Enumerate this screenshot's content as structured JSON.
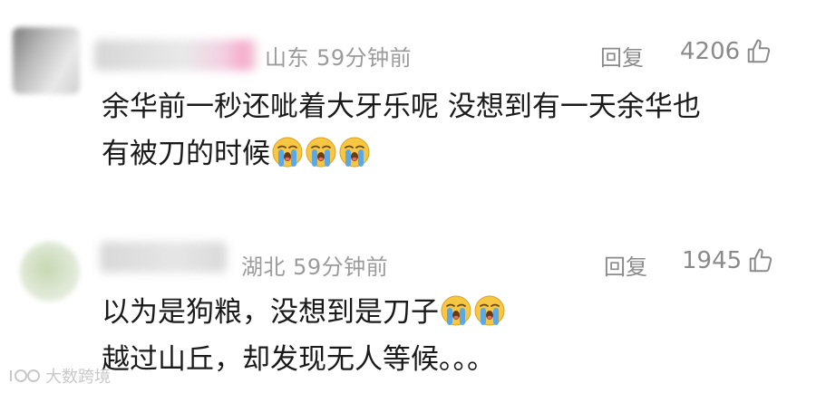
{
  "comments": [
    {
      "location": "山东",
      "time": "59分钟前",
      "reply_label": "回复",
      "like_count": "4206",
      "lines": [
        "余华前一秒还呲着大牙乐呢 没想到有一天余华也",
        "有被刀的时候"
      ],
      "emoji_count": 3
    },
    {
      "location": "湖北",
      "time": "59分钟前",
      "reply_label": "回复",
      "like_count": "1945",
      "lines": [
        "以为是狗粮，没想到是刀子",
        "越过山丘，却发现无人等候。。。"
      ],
      "emoji_count": 2
    }
  ],
  "watermark": {
    "text": "大数跨境"
  },
  "colors": {
    "meta_gray": "#9b9b9b",
    "text_dark": "#1a1a1a",
    "emoji_yellow": "#f7c744",
    "emoji_tears": "#5aa9e6"
  },
  "icons": {
    "like": "thumb-up-icon",
    "emoji": "loudly-crying-face-emoji"
  }
}
